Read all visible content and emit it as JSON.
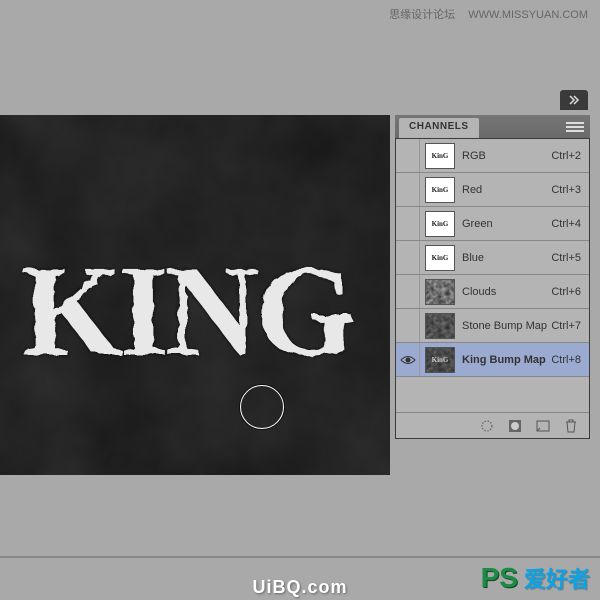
{
  "header": {
    "cn_text": "思缘设计论坛",
    "url_text": "WWW.MISSYUAN.COM"
  },
  "canvas": {
    "text": "KING"
  },
  "panel": {
    "tab_label": "CHANNELS",
    "channels": [
      {
        "name": "RGB",
        "shortcut": "Ctrl+2",
        "visible": false,
        "selected": false,
        "thumb": "king-white"
      },
      {
        "name": "Red",
        "shortcut": "Ctrl+3",
        "visible": false,
        "selected": false,
        "thumb": "king-white"
      },
      {
        "name": "Green",
        "shortcut": "Ctrl+4",
        "visible": false,
        "selected": false,
        "thumb": "king-white"
      },
      {
        "name": "Blue",
        "shortcut": "Ctrl+5",
        "visible": false,
        "selected": false,
        "thumb": "king-white"
      },
      {
        "name": "Clouds",
        "shortcut": "Ctrl+6",
        "visible": false,
        "selected": false,
        "thumb": "clouds"
      },
      {
        "name": "Stone Bump Map",
        "shortcut": "Ctrl+7",
        "visible": false,
        "selected": false,
        "thumb": "stone"
      },
      {
        "name": "King Bump Map",
        "shortcut": "Ctrl+8",
        "visible": true,
        "selected": true,
        "thumb": "kingbm"
      }
    ]
  },
  "footer_icons": {
    "load_selection": "load-selection-icon",
    "save_selection": "save-selection-mask-icon",
    "new_channel": "new-channel-icon",
    "delete_channel": "trash-icon"
  },
  "watermark": {
    "ps": "PS",
    "text": "爱好者",
    "url": "UiBQ.com"
  }
}
